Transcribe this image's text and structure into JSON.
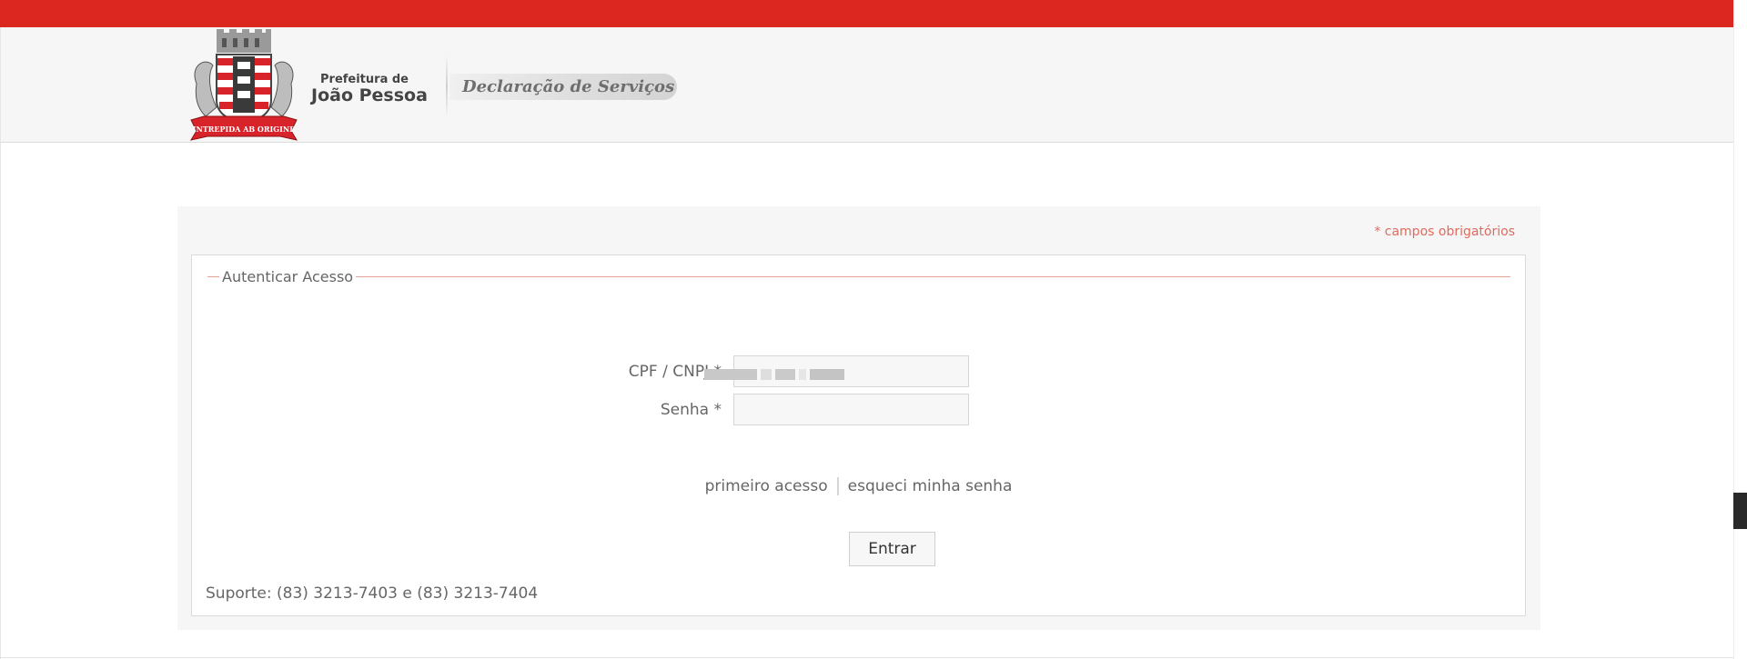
{
  "header": {
    "org_small": "Prefeitura de",
    "org_name": "João Pessoa",
    "logo_motto": "INTREPIDA AB ORIGINE",
    "service_title": "Declaração de Serviços"
  },
  "colors": {
    "brand_red": "#dc2620",
    "required_text": "#e06a5e",
    "legend_line": "#e8a197"
  },
  "form": {
    "required_note": "* campos obrigatórios",
    "legend": "Autenticar Acesso",
    "cpf_label": "CPF / CNPJ *",
    "cpf_value": "",
    "senha_label": "Senha *",
    "senha_value": "",
    "link_first_access": "primeiro acesso",
    "link_forgot": "esqueci minha senha",
    "submit_label": "Entrar",
    "support": "Suporte: (83) 3213-7403 e (83) 3213-7404"
  }
}
